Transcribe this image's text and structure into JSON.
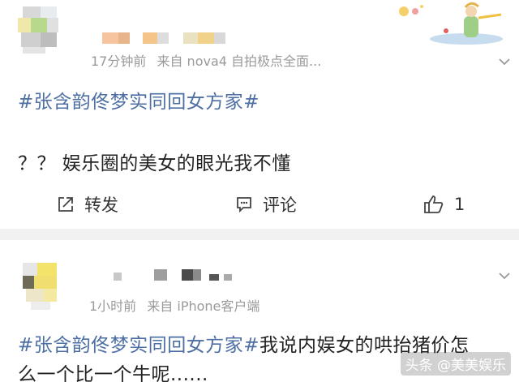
{
  "posts": [
    {
      "meta": {
        "time": "17分钟前",
        "source": "来自 nova4 自拍极点全面..."
      },
      "body_line1": {
        "tag": "#张含韵佟梦实同回女方家#"
      },
      "body_line2": "？？ 娱乐圈的美女的眼光我不懂",
      "actions": {
        "repost": "转发",
        "comment": "评论",
        "like_count": "1"
      }
    },
    {
      "meta": {
        "time": "1小时前",
        "source": "来自 iPhone客户端"
      },
      "body_line1": {
        "tag": "#张含韵佟梦实同回女方家#",
        "text": "我说内娱女的哄抬猪价怎"
      },
      "body_line2": "么一个比一个牛呢......"
    }
  ],
  "watermark": "头条 @美美娱乐",
  "icons": [
    "repost-icon",
    "comment-icon",
    "like-icon",
    "chevron-down-icon"
  ],
  "colors": {
    "tag": "#4d6fa3",
    "meta": "#9a9a9a",
    "separator": "#f1f1f1"
  }
}
